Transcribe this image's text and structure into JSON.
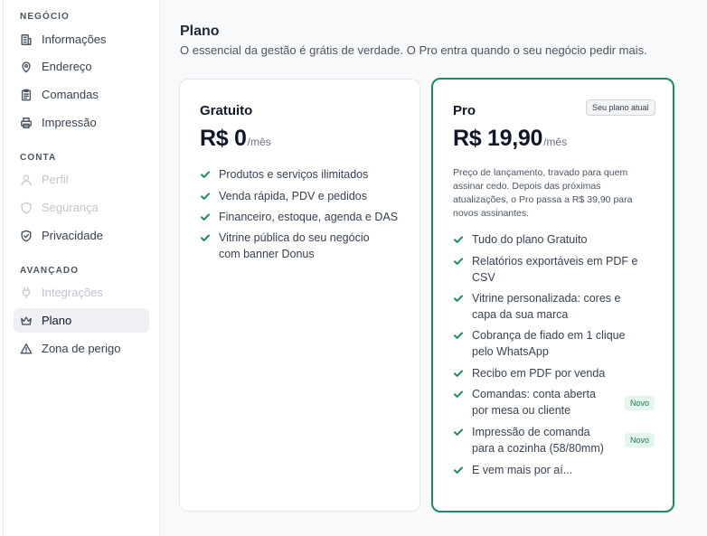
{
  "sidebar": {
    "sections": [
      {
        "title": "NEGÓCIO"
      },
      {
        "title": "CONTA"
      },
      {
        "title": "AVANÇADO"
      }
    ],
    "items": [
      {
        "label": "Informações",
        "icon": "building-icon",
        "state": "normal"
      },
      {
        "label": "Endereço",
        "icon": "map-pin-icon",
        "state": "normal"
      },
      {
        "label": "Comandas",
        "icon": "clipboard-icon",
        "state": "normal"
      },
      {
        "label": "Impressão",
        "icon": "printer-icon",
        "state": "normal"
      },
      {
        "label": "Perfil",
        "icon": "user-icon",
        "state": "disabled"
      },
      {
        "label": "Segurança",
        "icon": "shield-icon",
        "state": "disabled"
      },
      {
        "label": "Privacidade",
        "icon": "shield-check-icon",
        "state": "normal"
      },
      {
        "label": "Integrações",
        "icon": "plug-icon",
        "state": "disabled"
      },
      {
        "label": "Plano",
        "icon": "crown-icon",
        "state": "active"
      },
      {
        "label": "Zona de perigo",
        "icon": "warning-triangle-icon",
        "state": "normal"
      }
    ]
  },
  "main": {
    "title": "Plano",
    "subtitle": "O essencial da gestão é grátis de verdade. O Pro entra quando o seu negócio pedir mais."
  },
  "plans": {
    "free": {
      "name": "Gratuito",
      "price": "R$ 0",
      "period": "/mês",
      "features": [
        "Produtos e serviços ilimitados",
        "Venda rápida, PDV e pedidos",
        "Financeiro, estoque, agenda e DAS",
        "Vitrine pública do seu negócio\ncom banner Donus"
      ]
    },
    "pro": {
      "name": "Pro",
      "badge": "Seu plano atual",
      "price": "R$ 19,90",
      "period": "/mês",
      "note": "Preço de lançamento, travado para quem assinar cedo. Depois das próximas atualizações, o Pro passa a R$ 39,90 para novos assinantes.",
      "new_badge": "Novo",
      "features": [
        "Tudo do plano Gratuito",
        "Relatórios exportáveis em PDF e\nCSV",
        "Vitrine personalizada: cores e\ncapa da sua marca",
        "Cobrança de fiado em 1 clique\npelo WhatsApp",
        "Recibo em PDF por venda",
        "Comandas: conta aberta\npor mesa ou cliente",
        "Impressão de comanda\npara a cozinha (58/80mm)",
        "E vem mais por aí..."
      ]
    }
  },
  "colors": {
    "accent": "#1c8a5e",
    "new_badge_bg": "#e3f5ec",
    "active_item_bg": "#eef0f3"
  }
}
